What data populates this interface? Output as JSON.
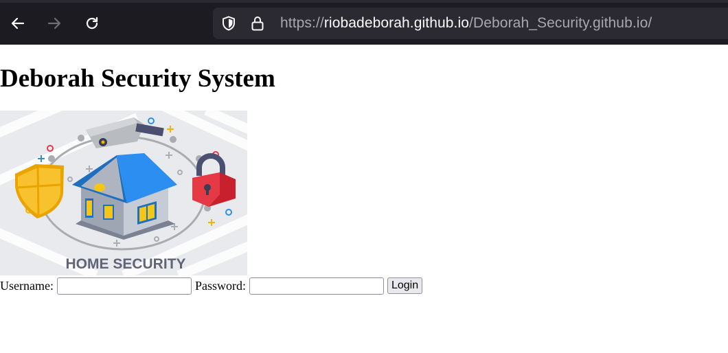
{
  "browser": {
    "url_prefix": "https://",
    "url_host": "riobadeborah.github.io",
    "url_path": "/Deborah_Security.github.io/",
    "icons": {
      "back": "arrow-left-icon",
      "forward": "arrow-right-icon",
      "reload": "reload-icon",
      "shield": "shield-icon",
      "lock": "lock-icon"
    }
  },
  "page": {
    "title": "Deborah Security System",
    "hero_caption": "HOME SECURITY"
  },
  "login": {
    "username_label": "Username:",
    "password_label": "Password:",
    "username_value": "",
    "password_value": "",
    "submit_label": "Login"
  }
}
